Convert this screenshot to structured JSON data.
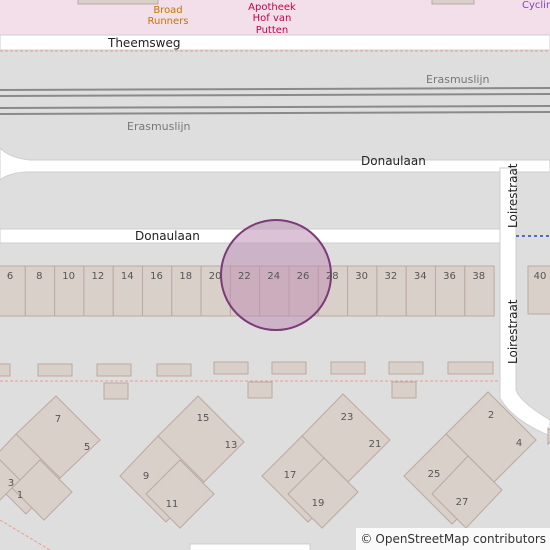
{
  "pois": {
    "broad_runners": {
      "line1": "Broad",
      "line2": "Runners"
    },
    "apotheek": {
      "line1": "Apotheek",
      "line2": "Hof van",
      "line3": "Putten"
    },
    "cycling": {
      "label": "Cyclin"
    }
  },
  "streets": {
    "theemsweg": "Theemsweg",
    "donaulaan_upper": "Donaulaan",
    "donaulaan_lower": "Donaulaan",
    "loirestraat_upper": "Loirestraat",
    "loirestraat_lower": "Loirestraat"
  },
  "rail": {
    "erasmuslijn_upper": "Erasmuslijn",
    "erasmuslijn_lower": "Erasmuslijn"
  },
  "row_house_numbers": [
    "6",
    "8",
    "10",
    "12",
    "14",
    "16",
    "18",
    "20",
    "22",
    "24",
    "26",
    "28",
    "30",
    "32",
    "34",
    "36",
    "38",
    "40"
  ],
  "cluster_numbers": {
    "c1": [
      "7",
      "5",
      "3",
      "1"
    ],
    "c2": [
      "15",
      "13",
      "9",
      "11"
    ],
    "c3": [
      "23",
      "21",
      "17",
      "19"
    ],
    "c4": [
      "2",
      "4",
      "25",
      "27"
    ]
  },
  "attribution": {
    "symbol": "©",
    "text": "OpenStreetMap contributors"
  },
  "colors": {
    "background": "#dedede",
    "building_fill": "#d9d0c9",
    "building_stroke": "#bca9a3",
    "road": "#ffffff",
    "highlight_fill": "#bf8fb5",
    "highlight_stroke": "#7a3b78",
    "path_red": "#f09a8f",
    "path_blue": "#4b6bd6",
    "poi_zone": "#f2dfe9"
  }
}
